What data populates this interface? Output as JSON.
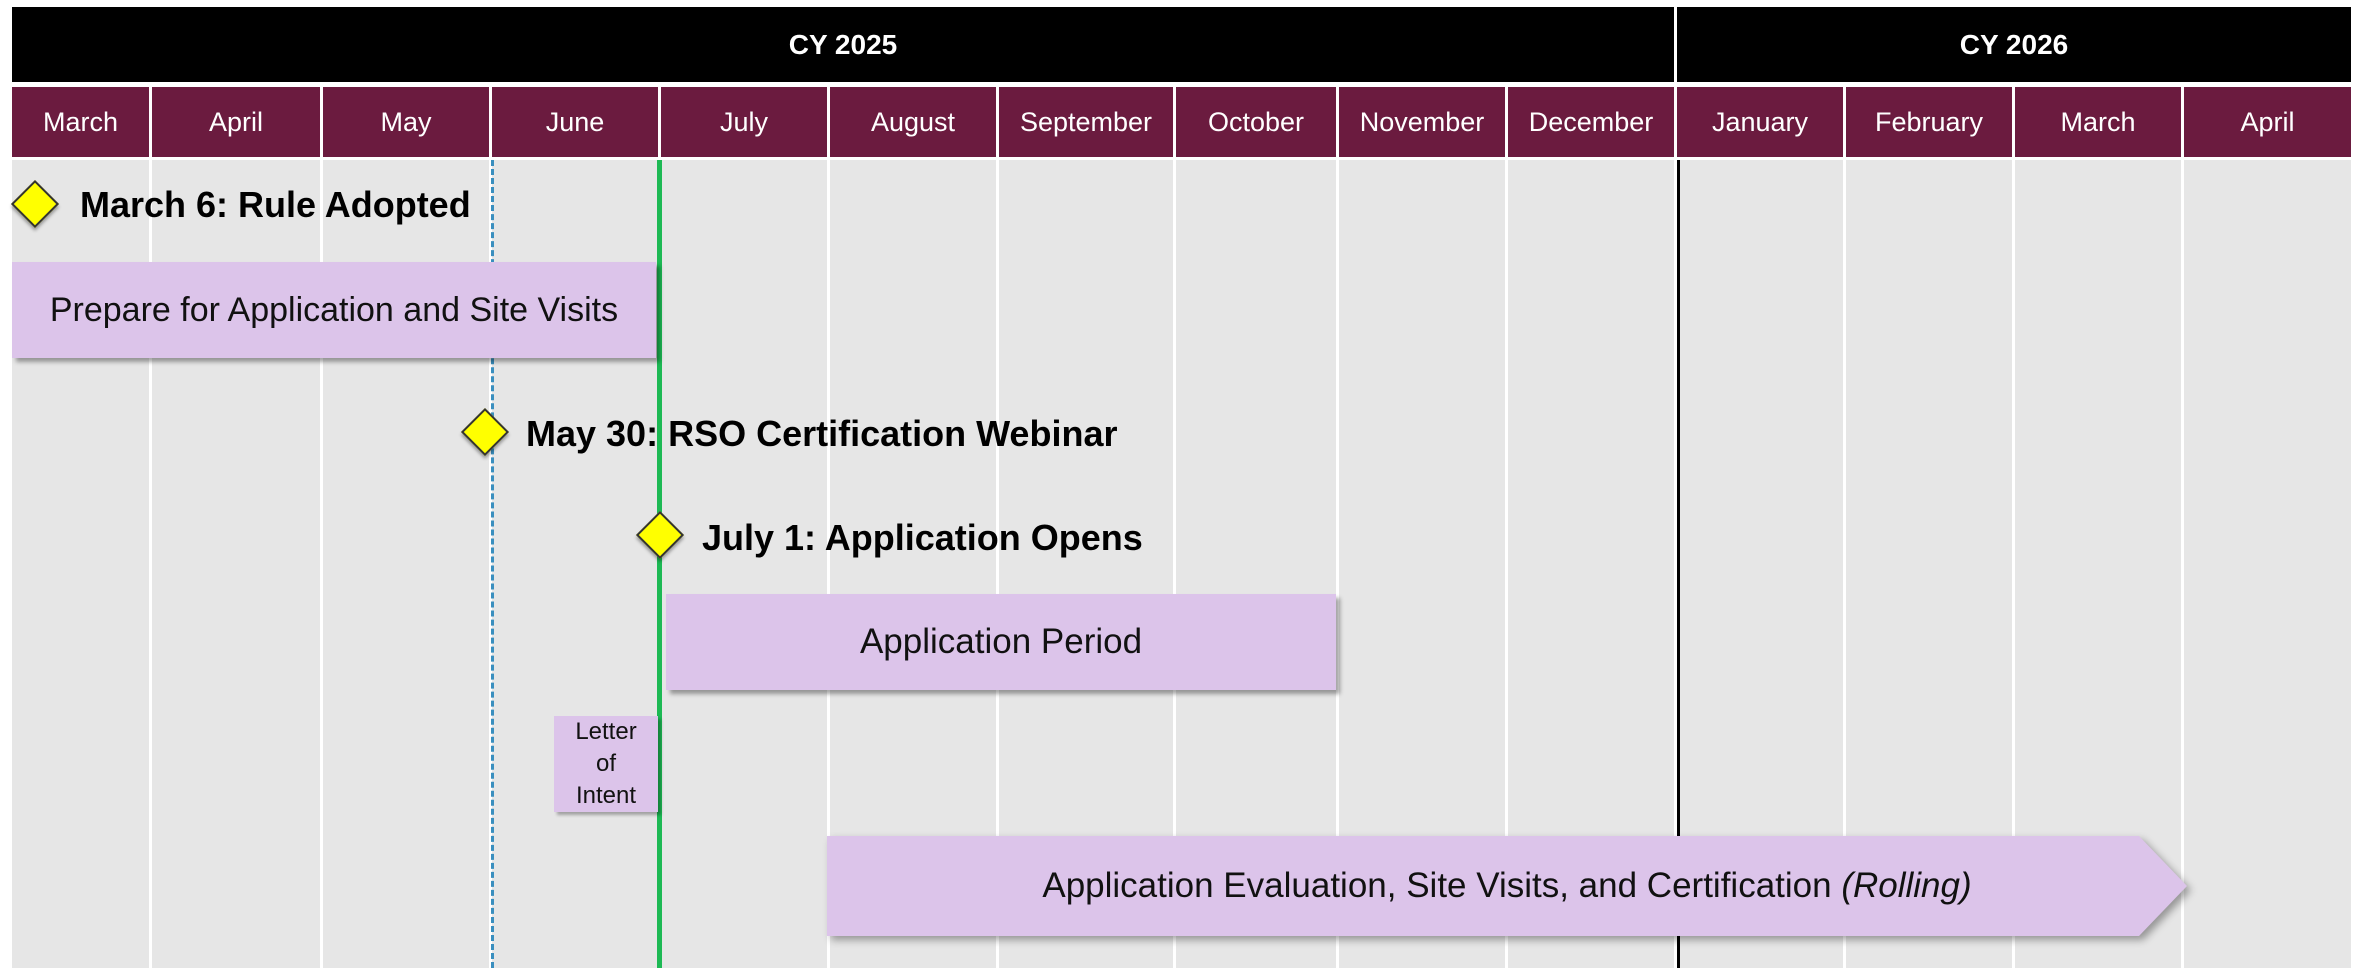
{
  "years": [
    {
      "label": "CY 2025"
    },
    {
      "label": "CY 2026"
    }
  ],
  "months": [
    "March",
    "April",
    "May",
    "June",
    "July",
    "August",
    "September",
    "October",
    "November",
    "December",
    "January",
    "February",
    "March",
    "April"
  ],
  "milestones": [
    {
      "label": "March 6: Rule Adopted"
    },
    {
      "label": "May 30: RSO Certification Webinar"
    },
    {
      "label": "July 1: Application Opens"
    }
  ],
  "bars": [
    {
      "label": "Prepare for Application and Site Visits"
    },
    {
      "label": "Application Period"
    },
    {
      "label": "Letter of Intent"
    },
    {
      "label": "Application Evaluation, Site Visits, and Certification",
      "italic_suffix": "(Rolling)"
    }
  ],
  "colors": {
    "year_band": "#000000",
    "month_band": "#6b1b3f",
    "bar_fill": "#dcc4ea",
    "milestone_fill": "#ffff00",
    "today_line": "#1db954",
    "dashed_line": "#3a8fbf",
    "grid_bg": "#e6e6e6"
  }
}
